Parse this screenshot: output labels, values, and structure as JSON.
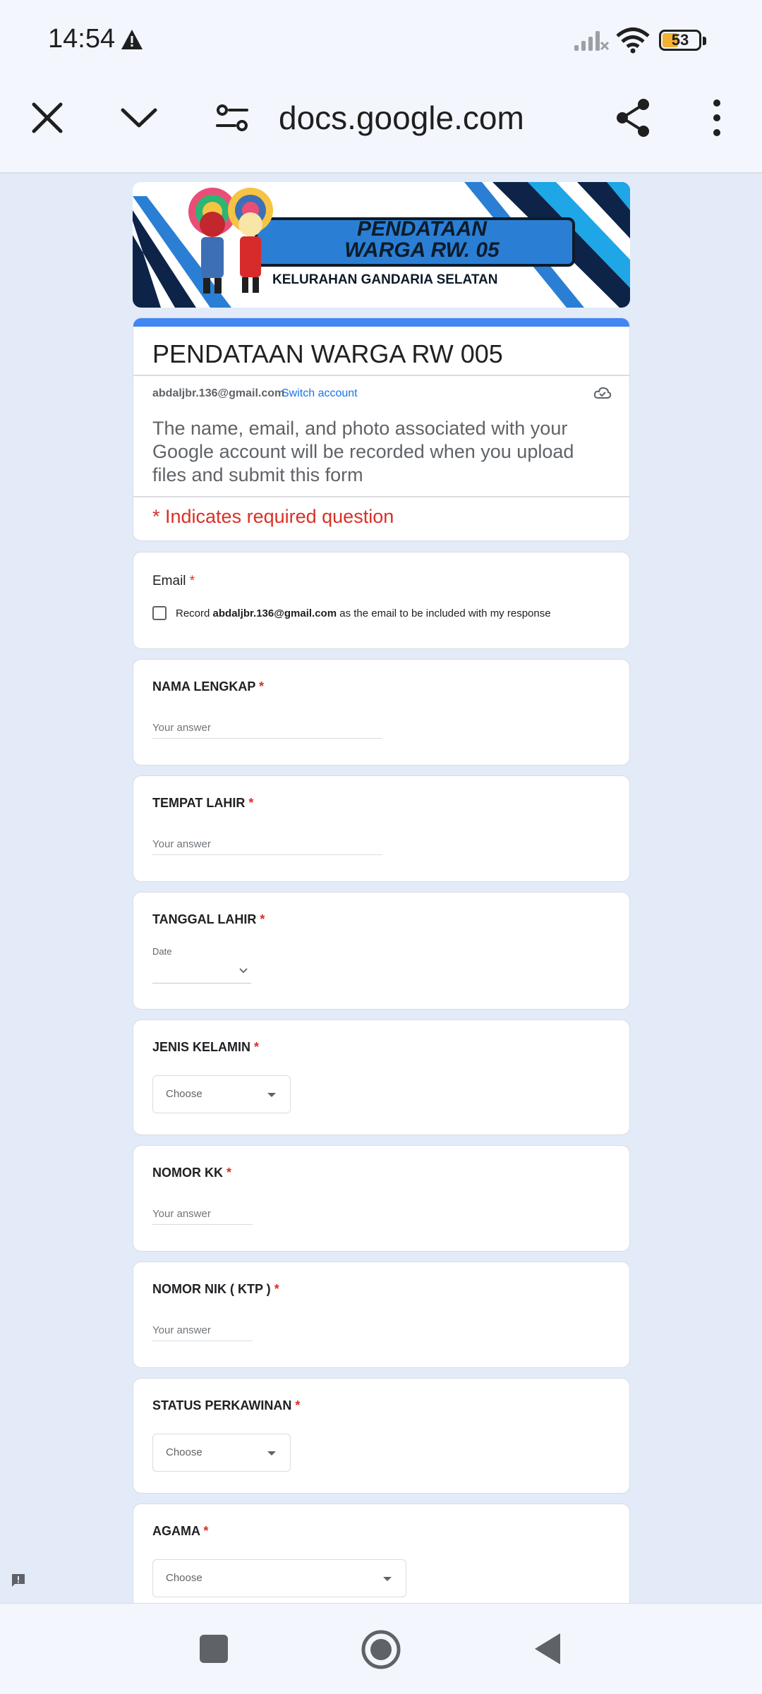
{
  "status_bar": {
    "time": "14:54",
    "battery": "53"
  },
  "browser": {
    "url": "docs.google.com"
  },
  "banner": {
    "title_line1": "PENDATAAN",
    "title_line2": "WARGA RW. 05",
    "subtitle": "KELURAHAN GANDARIA SELATAN"
  },
  "form": {
    "title": "PENDATAAN WARGA RW 005",
    "account_email": "abdaljbr.136@gmail.com",
    "switch_account": "Switch account",
    "notice": "The name, email, and photo associated with your Google account will be recorded when you upload files and submit this form",
    "required_note": "* Indicates required question"
  },
  "questions": {
    "email": {
      "label": "Email",
      "star": "*",
      "record_prefix": "Record",
      "record_email": "abdaljbr.136@gmail.com",
      "record_suffix": "as the email to be included with my response"
    },
    "nama": {
      "label": "NAMA LENGKAP",
      "star": "*",
      "placeholder": "Your answer"
    },
    "tempat": {
      "label": "TEMPAT LAHIR",
      "star": "*",
      "placeholder": "Your answer"
    },
    "tanggal": {
      "label": "TANGGAL LAHIR",
      "star": "*",
      "date_label": "Date"
    },
    "jenis": {
      "label": "JENIS KELAMIN",
      "star": "*",
      "select": "Choose"
    },
    "kk": {
      "label": "NOMOR KK",
      "star": "*",
      "placeholder": "Your answer"
    },
    "nik": {
      "label": "NOMOR NIK ( KTP )",
      "star": "*",
      "placeholder": "Your answer"
    },
    "status": {
      "label": "STATUS PERKAWINAN",
      "star": "*",
      "select": "Choose"
    },
    "agama": {
      "label": "AGAMA",
      "star": "*",
      "select": "Choose"
    }
  },
  "colors": {
    "accent": "#4285f4",
    "required": "#d93025",
    "link": "#1a73e8",
    "background": "#e3ebf9"
  },
  "icons": [
    "warning-icon",
    "signal-icon",
    "wifi-icon",
    "battery-icon",
    "close-icon",
    "chevron-down-icon",
    "tune-icon",
    "share-icon",
    "more-vert-icon",
    "cloud-icon",
    "feedback-icon",
    "recents-icon",
    "home-icon",
    "back-icon"
  ]
}
